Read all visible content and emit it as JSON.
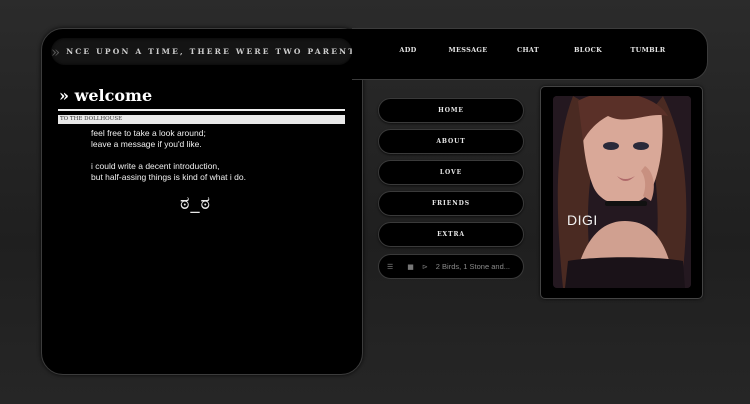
{
  "header": {
    "marquee_arrow": "»",
    "marquee_text": "nce upon a time, there were two parents, two c"
  },
  "nav": {
    "links": [
      "ADD",
      "MESSAGE",
      "CHAT",
      "BLOCK",
      "TUMBLR"
    ]
  },
  "welcome": {
    "title": "» welcome",
    "subtitle": "TO THE DOLLHOUSE",
    "lines": [
      "feel free to take a look around;",
      "leave a message if you'd like.",
      "i could write a decent introduction,",
      "but half-assing things is kind of what i do."
    ],
    "face": "ಠ_ಠ"
  },
  "sidebar": {
    "buttons": [
      "HOME",
      "ABOUT",
      "LOVE",
      "FRIENDS",
      "EXTRA"
    ]
  },
  "player": {
    "menu_icon": "☰",
    "stop_icon": "■",
    "next_icon": "⊳",
    "track": "2 Birds, 1 Stone and..."
  },
  "portrait": {
    "caption": "DIGI"
  }
}
